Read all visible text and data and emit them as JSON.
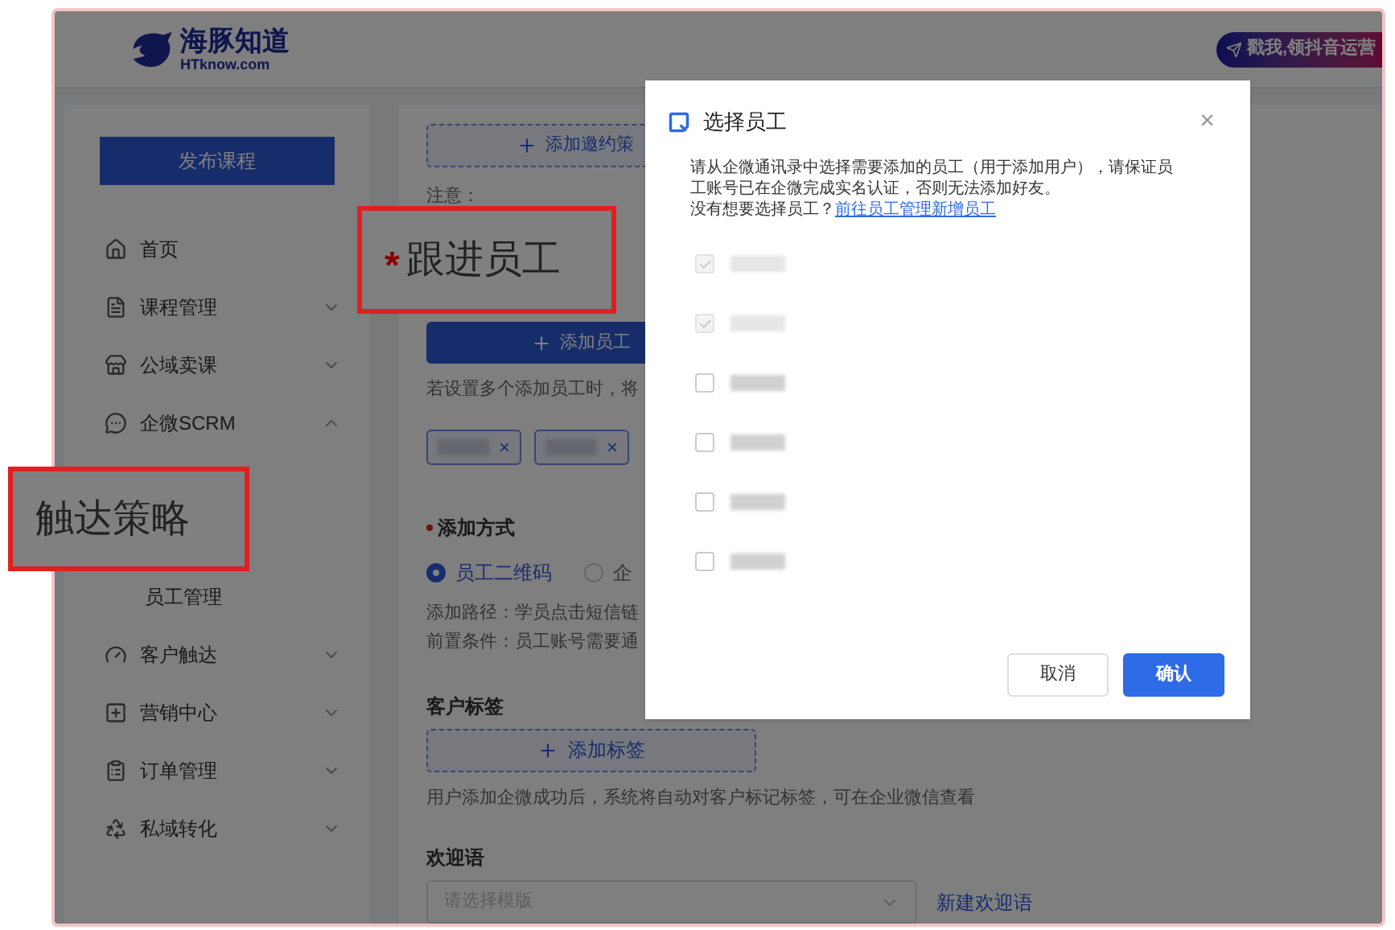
{
  "header": {
    "logo_name": "海豚知道",
    "logo_domain": "HTknow.com",
    "promo_banner": "戳我,领抖音运营"
  },
  "sidebar": {
    "publish_button": "发布课程",
    "items": [
      {
        "label": "首页",
        "kind": "link"
      },
      {
        "label": "课程管理",
        "kind": "group",
        "expanded": false
      },
      {
        "label": "公域卖课",
        "kind": "group",
        "expanded": false
      },
      {
        "label": "企微SCRM",
        "kind": "group",
        "expanded": true,
        "children": [
          {
            "label": "员工管理"
          }
        ]
      },
      {
        "label": "客户触达",
        "kind": "group",
        "expanded": false
      },
      {
        "label": "营销中心",
        "kind": "group",
        "expanded": false
      },
      {
        "label": "订单管理",
        "kind": "group",
        "expanded": false
      },
      {
        "label": "私域转化",
        "kind": "group",
        "expanded": false
      }
    ]
  },
  "main": {
    "invite_button": "添加邀约策",
    "note_label": "注意：",
    "staff_button": "添加员工",
    "staff_hint": "若设置多个添加员工时，将",
    "chips": [
      {
        "remove": "×"
      },
      {
        "remove": "×"
      }
    ],
    "add_method": {
      "label": "添加方式",
      "required": true,
      "options": [
        {
          "label": "员工二维码",
          "selected": true
        },
        {
          "label": "企",
          "selected": false
        }
      ],
      "path": "添加路径：学员点击短信链",
      "precondition": "前置条件：员工账号需要通"
    },
    "tags": {
      "label": "客户标签",
      "button": "添加标签",
      "hint": "用户添加企微成功后，系统将自动对客户标记标签，可在企业微信查看"
    },
    "welcome": {
      "label": "欢迎语",
      "placeholder": "请选择模版",
      "link": "新建欢迎语"
    }
  },
  "dialog": {
    "title": "选择员工",
    "close": "×",
    "description": "请从企微通讯录中选择需要添加的员工（用于添加用户），请保证员工账号已在企微完成实名认证，否则无法添加好友。",
    "prompt": "没有想要选择员工？",
    "link": "前往员工管理新增员工",
    "employees": [
      {
        "checked": true,
        "disabled": true
      },
      {
        "checked": true,
        "disabled": true
      },
      {
        "checked": false,
        "disabled": false
      },
      {
        "checked": false,
        "disabled": false
      },
      {
        "checked": false,
        "disabled": false
      },
      {
        "checked": false,
        "disabled": false
      }
    ],
    "cancel_button": "取消",
    "confirm_button": "确认"
  },
  "callouts": [
    {
      "text": "跟进员工",
      "marker": "*"
    },
    {
      "text": "触达策略"
    }
  ]
}
